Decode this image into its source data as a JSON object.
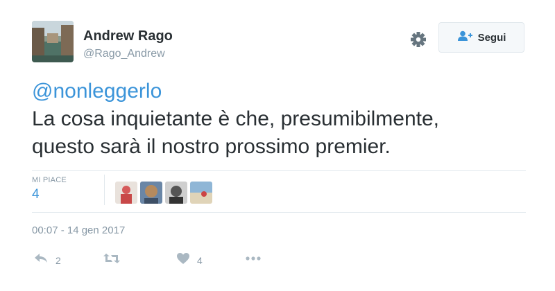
{
  "user": {
    "display_name": "Andrew Rago",
    "handle": "@Rago_Andrew"
  },
  "follow_button": {
    "label": "Segui"
  },
  "tweet": {
    "mention": "@nonleggerlo",
    "line1": "La cosa inquietante è che, presumibilmente,",
    "line2": "questo sarà il nostro prossimo premier."
  },
  "likes": {
    "label": "MI PIACE",
    "count": "4"
  },
  "timestamp": "00:07 - 14 gen 2017",
  "actions": {
    "reply_count": "2",
    "like_count": "4"
  },
  "icons": {
    "gear": "gear-icon",
    "follow": "add-user-icon",
    "reply": "reply-icon",
    "retweet": "retweet-icon",
    "like": "heart-icon",
    "more": "more-icon"
  },
  "colors": {
    "link": "#3b94d9",
    "muted": "#8899a6",
    "text": "#292f33",
    "border": "#e1e8ed"
  }
}
